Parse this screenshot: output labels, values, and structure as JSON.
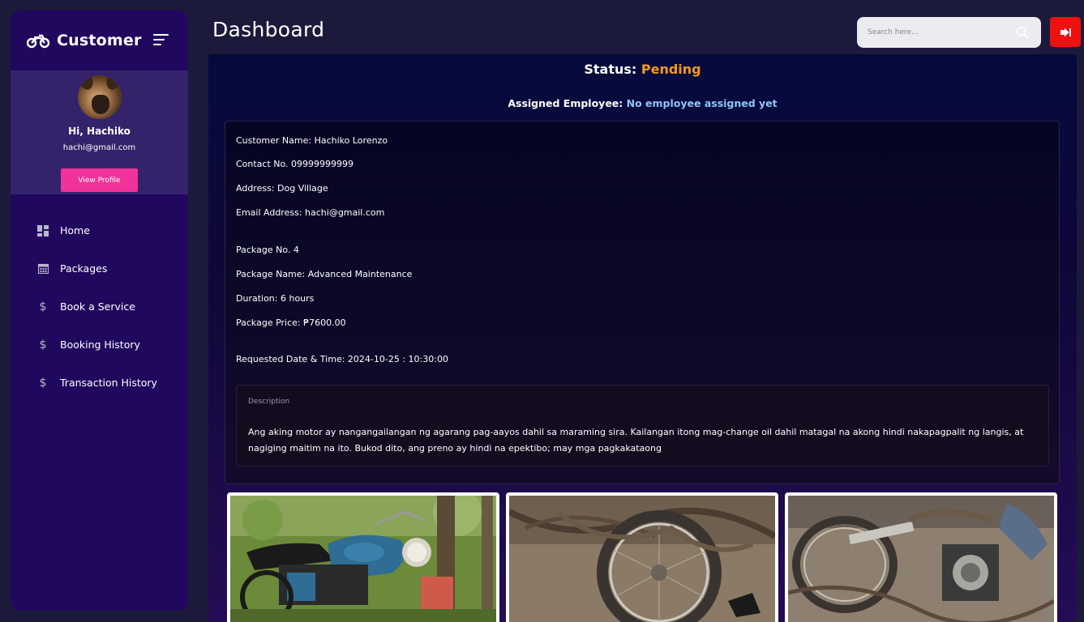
{
  "sidebar": {
    "brand": "Customer",
    "greeting": "Hi, Hachiko",
    "email": "hachi@gmail.com",
    "view_profile_label": "View Profile",
    "items": [
      {
        "label": "Home",
        "icon": "dashboard-grid-icon"
      },
      {
        "label": "Packages",
        "icon": "calendar-icon"
      },
      {
        "label": "Book a Service",
        "icon": "dollar-icon"
      },
      {
        "label": "Booking History",
        "icon": "dollar-icon"
      },
      {
        "label": "Transaction History",
        "icon": "dollar-icon"
      }
    ]
  },
  "header": {
    "title": "Dashboard",
    "search_placeholder": "Search here..."
  },
  "booking": {
    "status_label": "Status:",
    "status_value": "Pending",
    "assigned_label": "Assigned Employee:",
    "assigned_value": "No employee assigned yet",
    "customer_name": "Customer Name: Hachiko Lorenzo",
    "contact": "Contact No. 09999999999",
    "address": "Address: Dog Village",
    "email": "Email Address: hachi@gmail.com",
    "package_no": "Package No. 4",
    "package_name": "Package Name: Advanced Maintenance",
    "duration": "Duration: 6 hours",
    "package_price": "Package Price: ₱7600.00",
    "requested": "Requested Date & Time: 2024-10-25 : 10:30:00",
    "description_label": "Description",
    "description_text": "Ang aking motor ay nangangailangan ng agarang pag-aayos dahil sa maraming sira. Kailangan itong mag-change oil dahil matagal na akong hindi nakapagpalit ng langis, at nagiging maitim na ito. Bukod dito, ang preno ay hindi na epektibo; may mga pagkakataong"
  },
  "colors": {
    "status_pending": "#f59a1b",
    "assigned_value": "#8ec5f5",
    "view_profile_button": "#f0329a",
    "logout_button": "#ee1111"
  }
}
